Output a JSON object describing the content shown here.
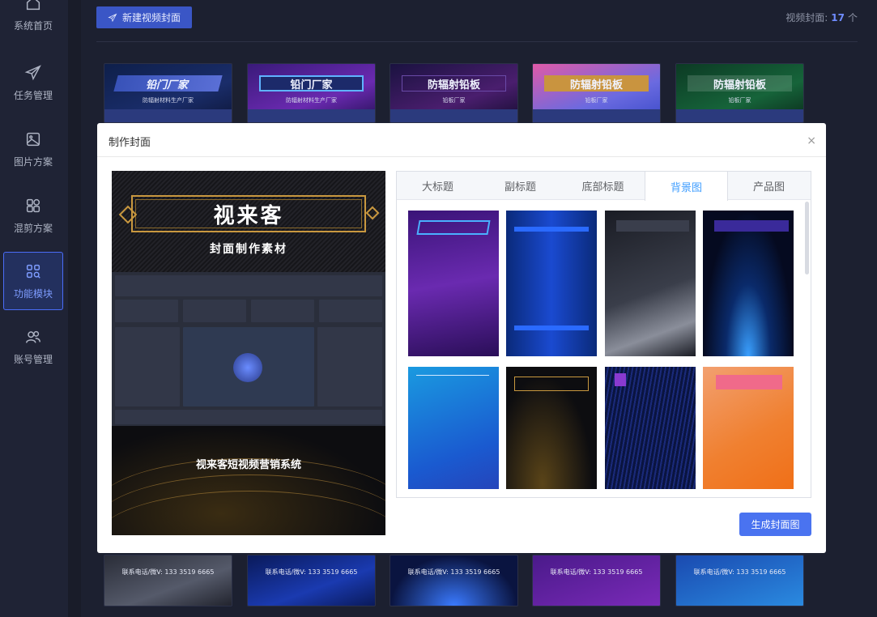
{
  "sidebar": {
    "items": [
      {
        "label": "系统首页",
        "icon": "home-icon"
      },
      {
        "label": "任务管理",
        "icon": "send-icon"
      },
      {
        "label": "图片方案",
        "icon": "image-icon"
      },
      {
        "label": "混剪方案",
        "icon": "grid-icon"
      },
      {
        "label": "功能模块",
        "icon": "module-search-icon",
        "active": true
      },
      {
        "label": "账号管理",
        "icon": "users-icon"
      }
    ]
  },
  "header": {
    "new_button": "新建视频封面",
    "count_label": "视频封面:",
    "count_value": "17",
    "count_unit": "个"
  },
  "covers_top": [
    {
      "title": "铅门厂家",
      "subtitle": "防辐射材料生产厂家"
    },
    {
      "title": "铅门厂家",
      "subtitle": "防辐射材料生产厂家"
    },
    {
      "title": "防辐射铅板",
      "subtitle": "铅板厂家"
    },
    {
      "title": "防辐射铅板",
      "subtitle": "铅板厂家"
    },
    {
      "title": "防辐射铅板",
      "subtitle": "铅板厂家"
    }
  ],
  "covers_bottom": [
    {
      "phone": "联系电话/微V: 133 3519 6665"
    },
    {
      "phone": "联系电话/微V: 133 3519 6665"
    },
    {
      "phone": "联系电话/微V: 133 3519 6665"
    },
    {
      "phone": "联系电话/微V: 133 3519 6665"
    },
    {
      "phone": "联系电话/微V: 133 3519 6665"
    }
  ],
  "modal": {
    "title": "制作封面",
    "close": "×",
    "preview": {
      "title": "视来客",
      "subtitle": "封面制作素材",
      "bottom_text": "视来客短视频营销系统"
    },
    "tabs": [
      {
        "label": "大标题"
      },
      {
        "label": "副标题"
      },
      {
        "label": "底部标题"
      },
      {
        "label": "背景图",
        "active": true
      },
      {
        "label": "产品图"
      }
    ],
    "generate_button": "生成封面图"
  },
  "colors": {
    "accent": "#4a73f0",
    "tab_active": "#409eff",
    "sidebar_active": "#7e9cff",
    "count_num": "#6f8cff"
  }
}
